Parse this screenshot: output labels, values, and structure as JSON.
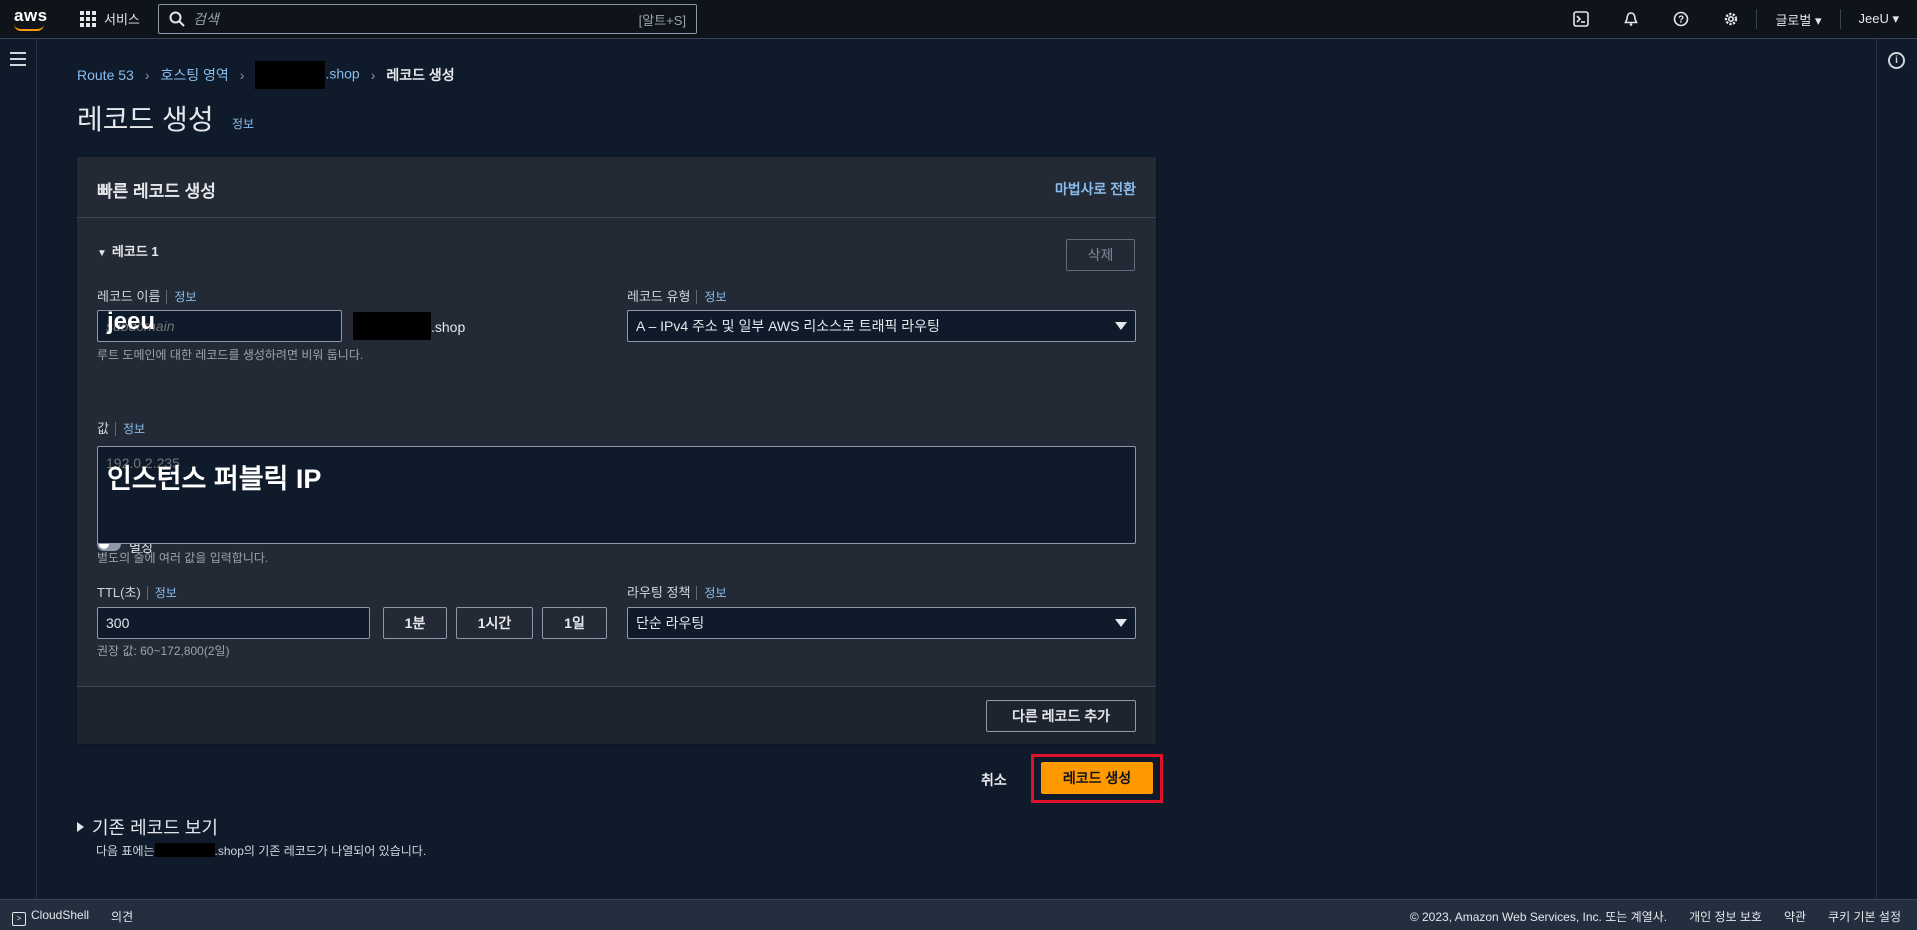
{
  "topnav": {
    "logo": "aws",
    "services": "서비스",
    "search_placeholder": "검색",
    "search_shortcut": "[알트+S]",
    "region": "글로벌 ▾",
    "user": "JeeU ▾"
  },
  "breadcrumb": {
    "items": [
      "Route 53",
      "호스팅 영역",
      ".shop"
    ],
    "current": "레코드 생성"
  },
  "page": {
    "title": "레코드 생성",
    "info": "정보"
  },
  "panel": {
    "heading": "빠른 레코드 생성",
    "wizard_link": "마법사로 전환",
    "record_toggle": "레코드 1",
    "delete_button": "삭제",
    "record_name": {
      "label": "레코드 이름",
      "info": "정보",
      "placeholder": "subdomain",
      "overlay": "jeeu",
      "domain_suffix": ".shop",
      "hint": "루트 도메인에 대한 레코드를 생성하려면 비워 둡니다."
    },
    "record_type": {
      "label": "레코드 유형",
      "info": "정보",
      "value": "A – IPv4 주소 및 일부 AWS 리소스로 트래픽 라우팅"
    },
    "alias": {
      "label": "별칭"
    },
    "value": {
      "label": "값",
      "info": "정보",
      "placeholder": "192.0.2.235",
      "overlay": "인스턴스 퍼블릭 IP",
      "hint": "별도의 줄에 여러 값을 입력합니다."
    },
    "ttl": {
      "label": "TTL(초)",
      "info": "정보",
      "value": "300",
      "presets": [
        "1분",
        "1시간",
        "1일"
      ],
      "hint": "권장 값: 60~172,800(2일)"
    },
    "routing": {
      "label": "라우팅 정책",
      "info": "정보",
      "value": "단순 라우팅"
    },
    "add_record": "다른 레코드 추가"
  },
  "actions": {
    "cancel": "취소",
    "create": "레코드 생성"
  },
  "existing": {
    "title": "기존 레코드 보기",
    "desc_prefix": "다음 표에는",
    "desc_suffix": ".shop의 기존 레코드가 나열되어 있습니다."
  },
  "footer": {
    "cloudshell": "CloudShell",
    "feedback": "의견",
    "copyright": "© 2023, Amazon Web Services, Inc. 또는 계열사.",
    "privacy": "개인 정보 보호",
    "terms": "약관",
    "cookies": "쿠키 기본 설정"
  },
  "colors": {
    "primary": "#ff9900",
    "highlight": "#e0112b",
    "link": "#89bdee",
    "panel": "#232a35"
  }
}
